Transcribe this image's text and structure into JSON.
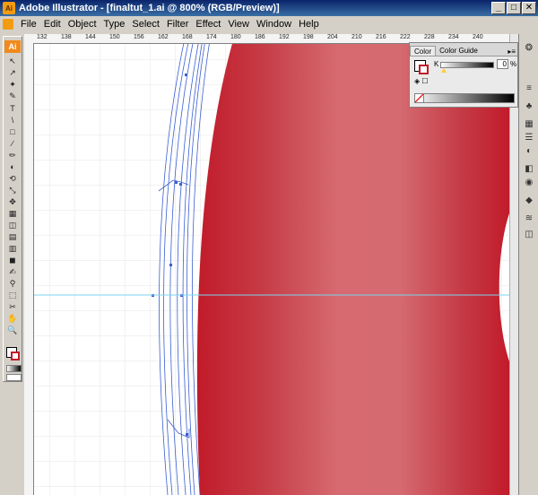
{
  "window": {
    "title": "Adobe Illustrator - [finaltut_1.ai @ 800% (RGB/Preview)]",
    "app_badge": "Ai",
    "controls": [
      "_",
      "□",
      "✕"
    ]
  },
  "menu": [
    "File",
    "Edit",
    "Object",
    "Type",
    "Select",
    "Filter",
    "Effect",
    "View",
    "Window",
    "Help"
  ],
  "ruler": {
    "ticks": [
      "132",
      "138",
      "144",
      "150",
      "156",
      "162",
      "168",
      "174",
      "180",
      "186",
      "192",
      "198",
      "204",
      "210",
      "216",
      "222",
      "228",
      "234",
      "240"
    ]
  },
  "color_panel": {
    "tabs": [
      "Color",
      "Color Guide"
    ],
    "channel_label": "K",
    "channel_value": "0",
    "unit": "%"
  },
  "tools": [
    "↖",
    "↗",
    "✦",
    "✎",
    "T",
    "\\",
    "□",
    "∕",
    "✏",
    "◐",
    "⟲",
    "⤡",
    "✥",
    "▦",
    "◫",
    "▤",
    "▥",
    "◼",
    "✍",
    "⚲",
    "⬚",
    "✂",
    "✋",
    "🔍"
  ],
  "dock_icons": [
    "❂",
    "≡",
    "♣",
    "▦",
    "☰",
    "◐",
    "◧",
    "◉",
    "◆",
    "≋",
    "◫"
  ],
  "colors": {
    "artwork_red": "#c21b2a",
    "guide_line": "#7fd3f0",
    "path_blue": "#3a5fd0"
  }
}
